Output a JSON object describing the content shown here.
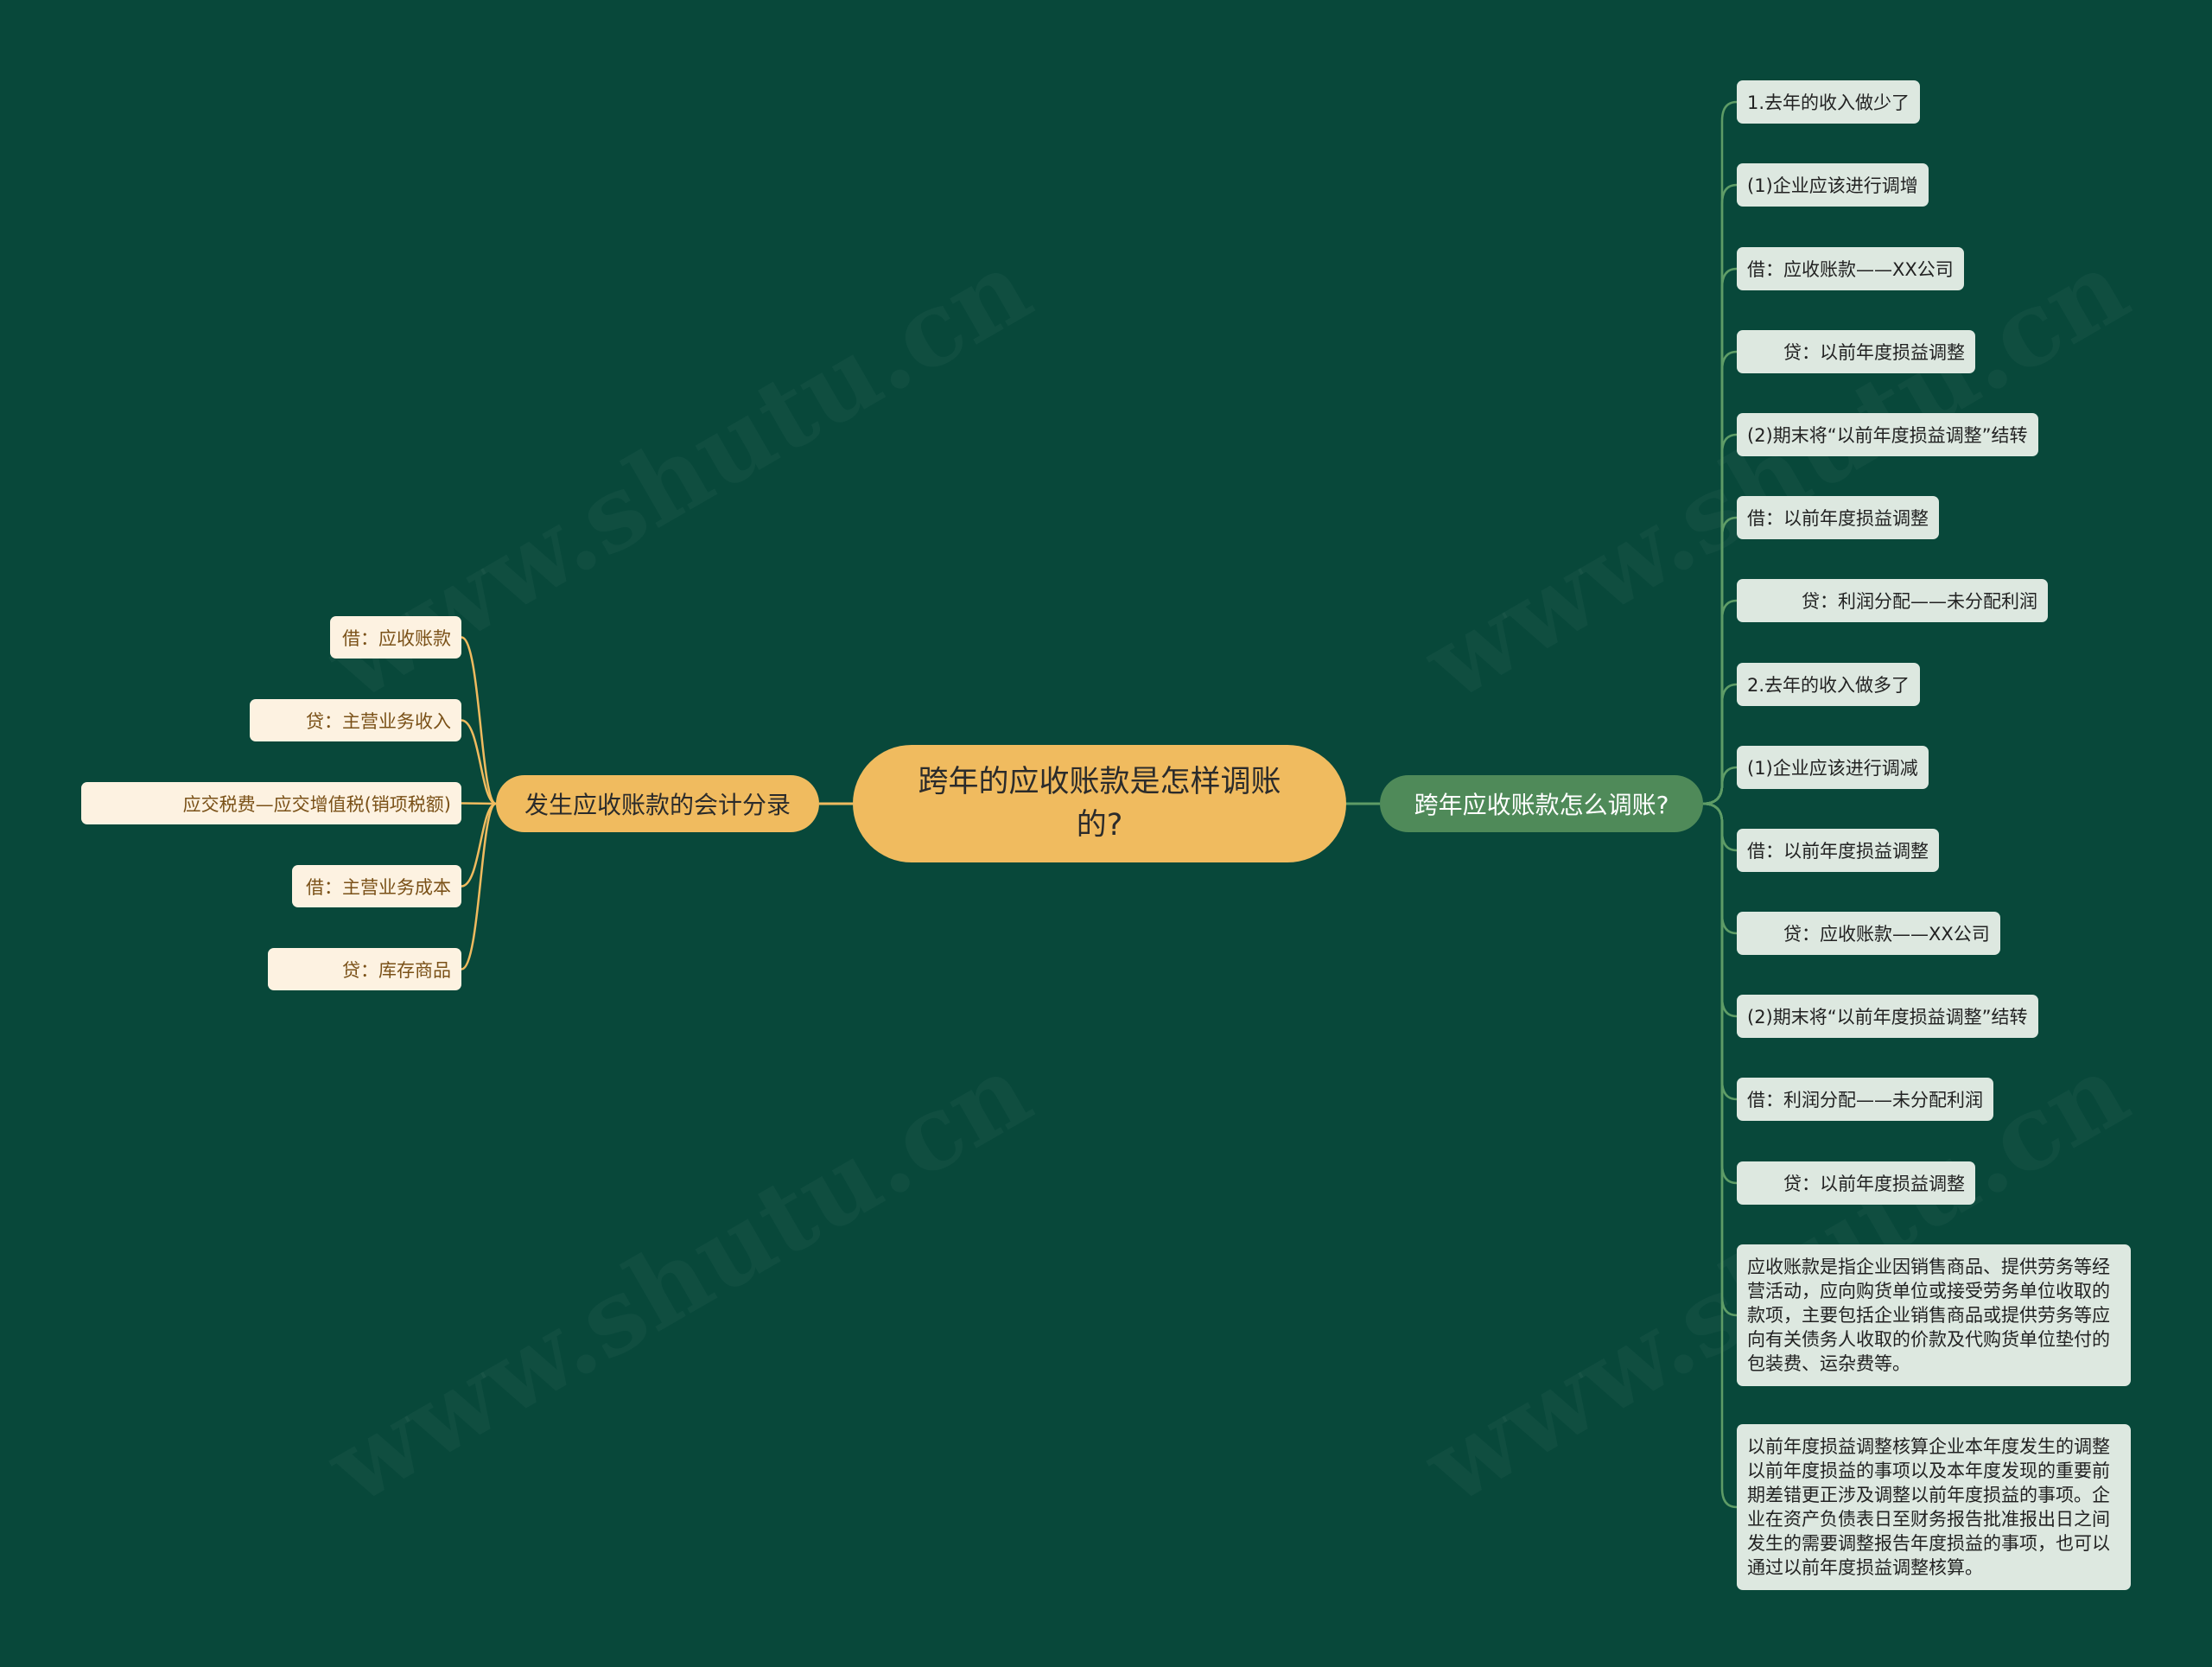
{
  "root": {
    "title": "跨年的应收账款是怎样调账的?"
  },
  "left_branch": {
    "label": "发生应收账款的会计分录",
    "items": [
      "借：应收账款",
      "贷：主营业务收入",
      "应交税费—应交增值税(销项税额)",
      "借：主营业务成本",
      "贷：库存商品"
    ]
  },
  "right_branch": {
    "label": "跨年应收账款怎么调账?",
    "items": [
      "1.去年的收入做少了",
      "(1)企业应该进行调增",
      "借：应收账款——XX公司",
      "　　贷：以前年度损益调整",
      "(2)期末将“以前年度损益调整”结转",
      "借：以前年度损益调整",
      "　　　贷：利润分配——未分配利润",
      "2.去年的收入做多了",
      "(1)企业应该进行调减",
      "借：以前年度损益调整",
      "　　贷：应收账款——XX公司",
      "(2)期末将“以前年度损益调整”结转",
      "借：利润分配——未分配利润",
      "　　贷：以前年度损益调整",
      "应收账款是指企业因销售商品、提供劳务等经营活动，应向购货单位或接受劳务单位收取的款项，主要包括企业销售商品或提供劳务等应向有关债务人收取的价款及代购货单位垫付的包装费、运杂费等。",
      "以前年度损益调整核算企业本年度发生的调整以前年度损益的事项以及本年度发现的重要前期差错更正涉及调整以前年度损益的事项。企业在资产负债表日至财务报告批准报出日之间发生的需要调整报告年度损益的事项，也可以通过以前年度损益调整核算。"
    ]
  },
  "colors": {
    "background": "#08483a",
    "root_fill": "#f0bb5f",
    "left_line": "#f0bb5f",
    "left_leaf_fill": "#fdf2e1",
    "right_branch_fill": "#4f8a59",
    "right_line": "#5e9c66",
    "right_leaf_fill": "#dde8e0"
  }
}
